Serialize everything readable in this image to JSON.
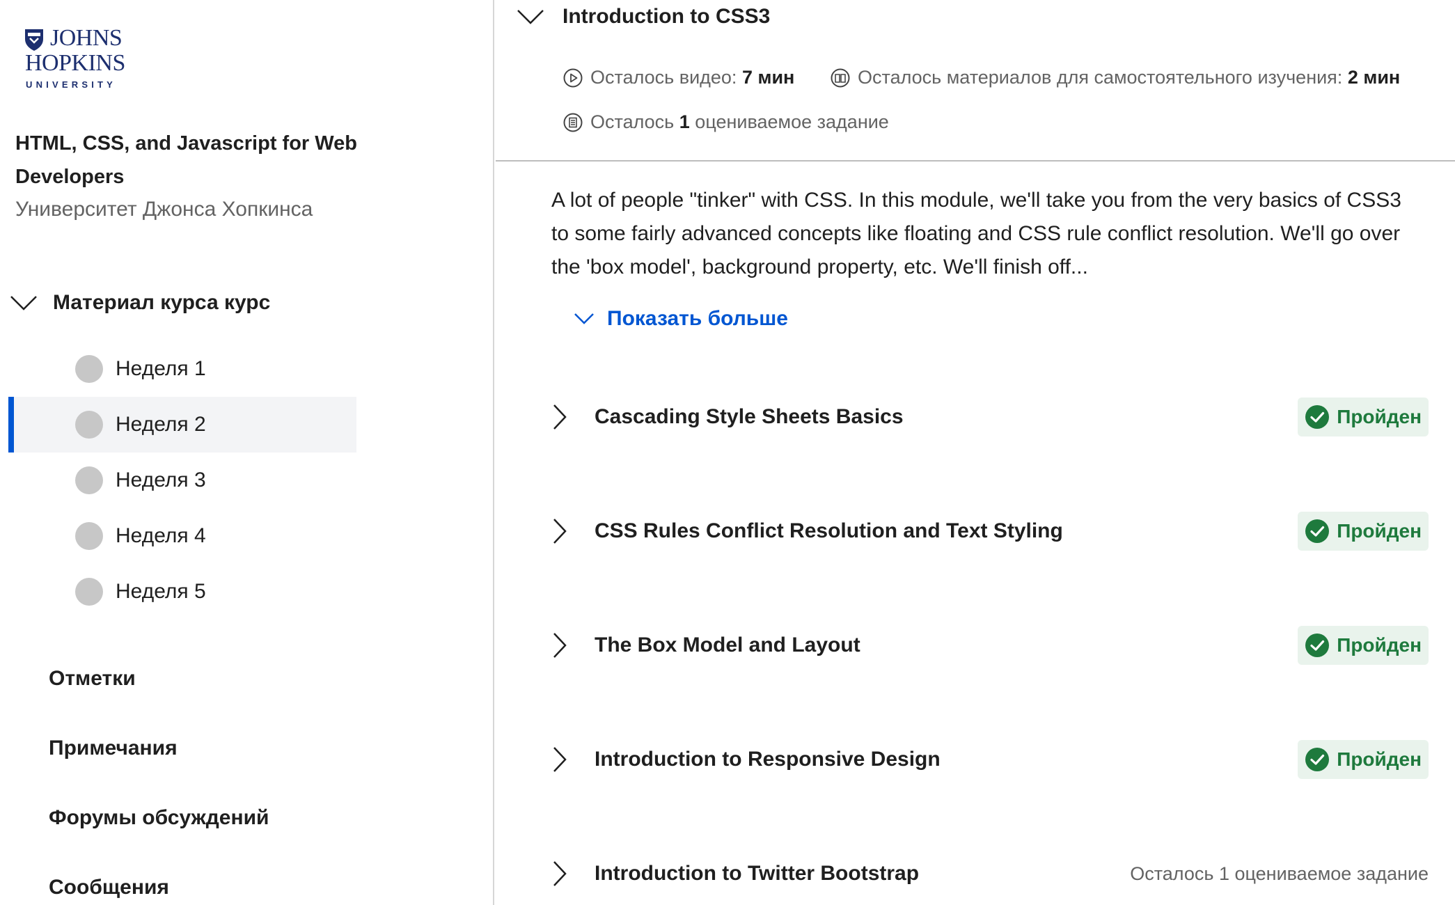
{
  "logo": {
    "line1": "JOHNS",
    "line2": "HOPKINS",
    "line3": "UNIVERSITY"
  },
  "sidebar": {
    "course_title": "HTML, CSS, and Javascript for Web Developers",
    "university": "Университет Джонса Хопкинса",
    "section_label": "Материал курса курс",
    "weeks": [
      {
        "label": "Неделя 1",
        "active": false
      },
      {
        "label": "Неделя 2",
        "active": true
      },
      {
        "label": "Неделя 3",
        "active": false
      },
      {
        "label": "Неделя 4",
        "active": false
      },
      {
        "label": "Неделя 5",
        "active": false
      }
    ],
    "links": {
      "grades": "Отметки",
      "notes": "Примечания",
      "forums": "Форумы обсуждений",
      "messages": "Сообщения"
    }
  },
  "main": {
    "module_title": "Introduction to CSS3",
    "meta": {
      "video_label": "Осталось видео:",
      "video_value": "7 мин",
      "reading_label": "Осталось материалов для самостоятельного изучения:",
      "reading_value": "2 мин",
      "graded_prefix": "Осталось",
      "graded_count": "1",
      "graded_suffix": "оцениваемое задание"
    },
    "description": "A lot of people \"tinker\" with CSS. In this module, we'll take you from the very basics of CSS3 to some fairly advanced concepts like floating and CSS rule conflict resolution. We'll go over the 'box model', background property, etc. We'll finish off...",
    "show_more": "Показать больше",
    "lessons": [
      {
        "title": "Cascading Style Sheets Basics",
        "status": "Пройден"
      },
      {
        "title": "CSS Rules Conflict Resolution and Text Styling",
        "status": "Пройден"
      },
      {
        "title": "The Box Model and Layout",
        "status": "Пройден"
      },
      {
        "title": "Introduction to Responsive Design",
        "status": "Пройден"
      },
      {
        "title": "Introduction to Twitter Bootstrap",
        "remaining": "Осталось 1 оцениваемое задание"
      }
    ]
  },
  "colors": {
    "accent": "#0056d2",
    "completed_text": "#1e7a3d",
    "completed_bg": "#e9f3ec",
    "logo_blue": "#1d2f6f"
  }
}
